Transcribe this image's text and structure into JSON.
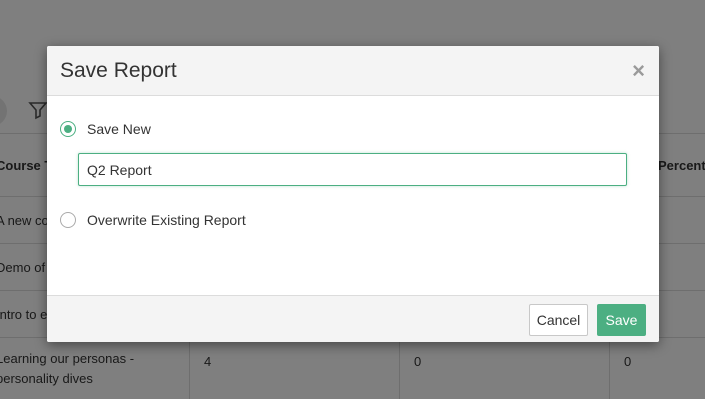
{
  "background": {
    "table": {
      "headers": [
        "Course T",
        "Percent"
      ],
      "rows": [
        [
          "A new co"
        ],
        [
          "Demo of"
        ],
        [
          "Intro to e"
        ],
        [
          "Learning our personas - personality dives",
          "4",
          "0",
          "0"
        ]
      ]
    }
  },
  "modal": {
    "title": "Save Report",
    "close_glyph": "×",
    "options": [
      {
        "label": "Save New",
        "checked": true
      },
      {
        "label": "Overwrite Existing Report",
        "checked": false
      }
    ],
    "name_input": {
      "value": "Q2 Report"
    },
    "buttons": {
      "cancel": "Cancel",
      "save": "Save"
    }
  },
  "colors": {
    "accent": "#4caf82",
    "overlay": "rgba(0,0,0,0.5)"
  }
}
